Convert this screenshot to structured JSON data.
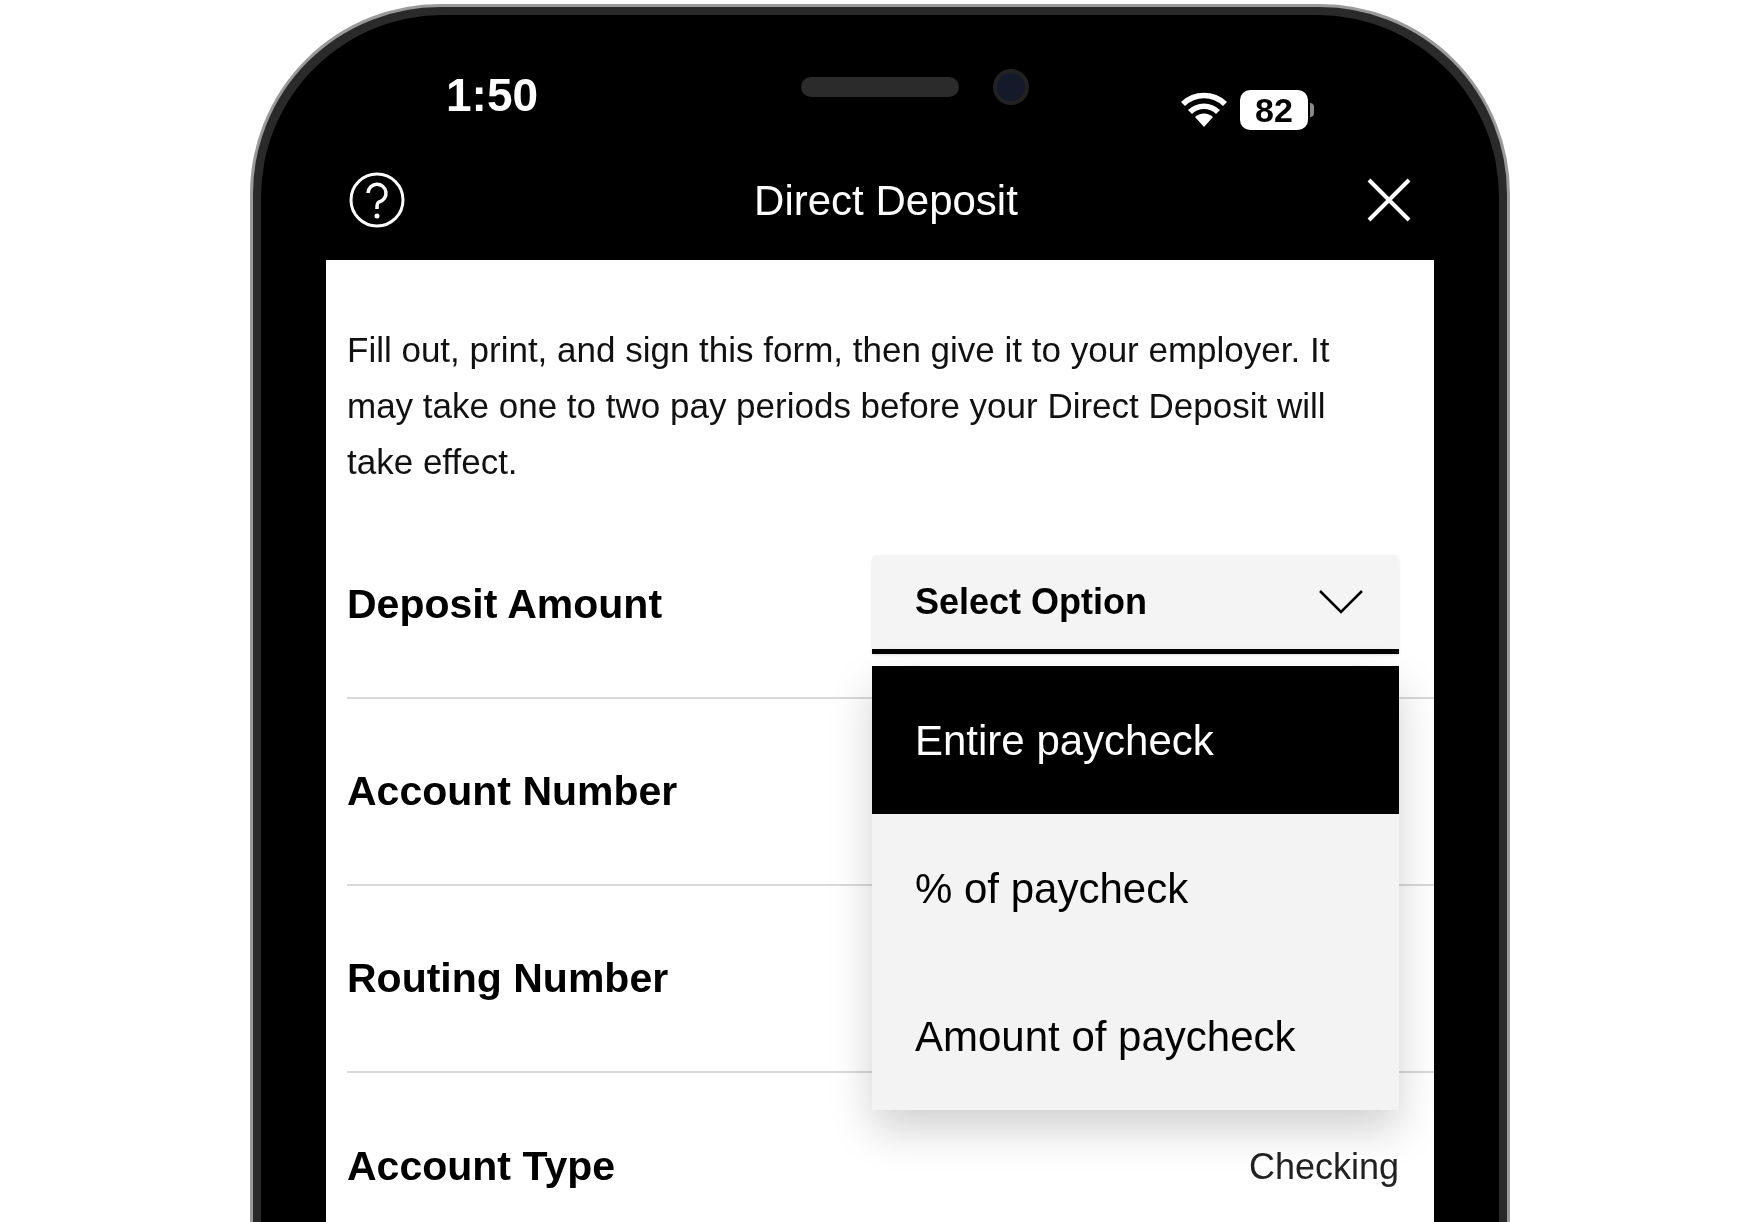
{
  "status_bar": {
    "time": "1:50",
    "battery": "82"
  },
  "header": {
    "title": "Direct Deposit"
  },
  "intro": "Fill out, print, and sign this form, then give it to your employer. It may take one to two pay periods before your Direct Deposit will take effect.",
  "fields": [
    {
      "label": "Deposit Amount",
      "kind": "select",
      "placeholder": "Select Option",
      "expanded": true
    },
    {
      "label": "Account Number",
      "kind": "text"
    },
    {
      "label": "Routing Number",
      "kind": "text"
    },
    {
      "label": "Account Type",
      "kind": "value",
      "value": "Checking"
    }
  ],
  "dropdown_options": [
    {
      "label": "Entire paycheck",
      "selected": true
    },
    {
      "label": "% of paycheck",
      "selected": false
    },
    {
      "label": "Amount of paycheck",
      "selected": false
    }
  ]
}
